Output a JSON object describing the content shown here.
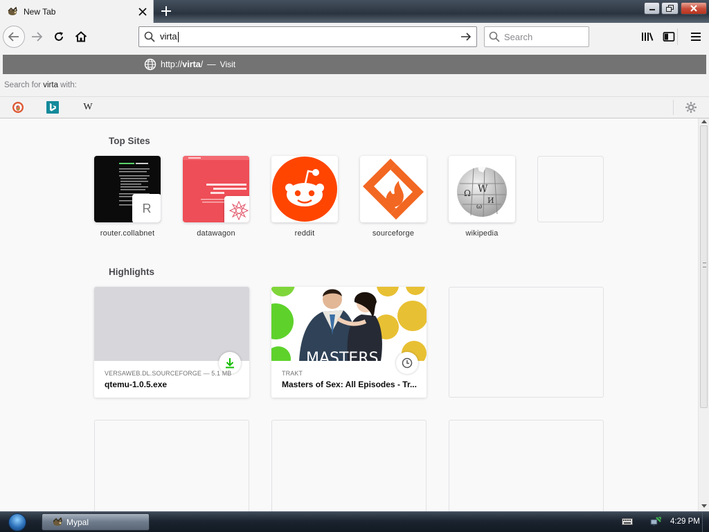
{
  "window": {
    "tab_title": "New Tab"
  },
  "toolbar": {
    "url_value": "virta",
    "search_placeholder": "Search"
  },
  "url_popup": {
    "url_prefix": "http://",
    "url_bold": "virta",
    "url_suffix": "/",
    "dash": "—",
    "action": "Visit",
    "search_for_prefix": "Search for ",
    "search_for_term": "virta",
    "search_for_suffix": " with:",
    "engines": [
      {
        "name": "DuckDuckGo",
        "icon": "duckduckgo-icon"
      },
      {
        "name": "Bing",
        "icon": "bing-icon"
      },
      {
        "name": "Wikipedia",
        "icon": "wikipedia-icon",
        "glyph": "W"
      }
    ]
  },
  "newtab": {
    "top_sites_title": "Top Sites",
    "highlights_title": "Highlights",
    "top_sites": [
      {
        "label": "router.collabnet",
        "letter": "R"
      },
      {
        "label": "datawagon"
      },
      {
        "label": "reddit"
      },
      {
        "label": "sourceforge"
      },
      {
        "label": "wikipedia"
      }
    ],
    "highlights": [
      {
        "source": "VERSAWEB.DL.SOURCEFORGE — 5.1 MB",
        "title": "qtemu-1.0.5.exe",
        "badge": "download-icon"
      },
      {
        "source": "TRAKT",
        "title": "Masters of Sex: All Episodes - Tr...",
        "badge": "clock-icon",
        "image_text": "MASTERS"
      }
    ]
  },
  "taskbar": {
    "app_label": "Mypal",
    "clock": "4:29 PM"
  },
  "colors": {
    "reddit": "#ff4500",
    "sourceforge": "#f26722",
    "datawagon": "#ee4e57",
    "download_green": "#12bc00",
    "popup_highlight": "#737373"
  }
}
